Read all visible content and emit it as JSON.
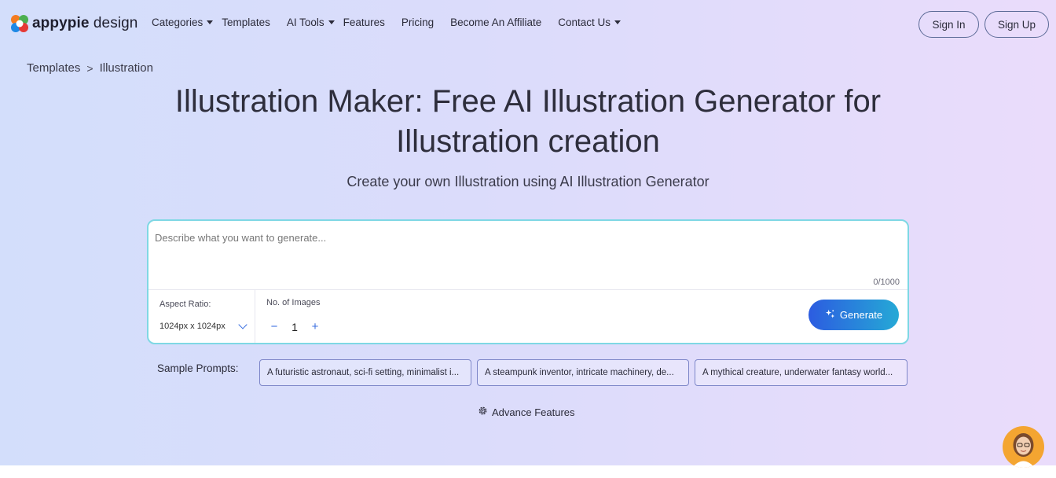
{
  "brand": {
    "name_bold": "appypie",
    "name_regular": " design"
  },
  "nav": {
    "items": [
      {
        "label": "Categories",
        "has_caret": true
      },
      {
        "label": "Templates",
        "has_caret": false
      },
      {
        "label": "AI Tools",
        "has_caret": true
      },
      {
        "label": "Features",
        "has_caret": false
      },
      {
        "label": "Pricing",
        "has_caret": false
      },
      {
        "label": "Become An Affiliate",
        "has_caret": false
      },
      {
        "label": "Contact Us",
        "has_caret": true
      }
    ],
    "sign_in": "Sign In",
    "sign_up": "Sign Up"
  },
  "breadcrumb": {
    "root": "Templates",
    "separator": ">",
    "current": "Illustration"
  },
  "hero": {
    "title_line1": "Illustration Maker: Free AI Illustration Generator for",
    "title_line2": "Illustration creation",
    "subtitle": "Create your own Illustration using AI Illustration Generator"
  },
  "prompt": {
    "placeholder": "Describe what you want to generate...",
    "value": "",
    "counter": "0/1000",
    "aspect_label": "Aspect Ratio:",
    "aspect_value": "1024px x 1024px",
    "count_label": "No. of Images",
    "count_value": "1",
    "minus": "−",
    "plus": "+",
    "generate_label": "Generate"
  },
  "samples": {
    "label": "Sample Prompts:",
    "items": [
      "A futuristic astronaut, sci-fi setting, minimalist i...",
      "A steampunk inventor, intricate machinery, de...",
      "A mythical creature, underwater fantasy world..."
    ]
  },
  "advance_label": "Advance Features",
  "colors": {
    "accent_blue": "#2c5ce0",
    "accent_cyan": "#25a9d6",
    "card_border": "#7fd8e4",
    "avatar_bg": "#f4a531"
  }
}
